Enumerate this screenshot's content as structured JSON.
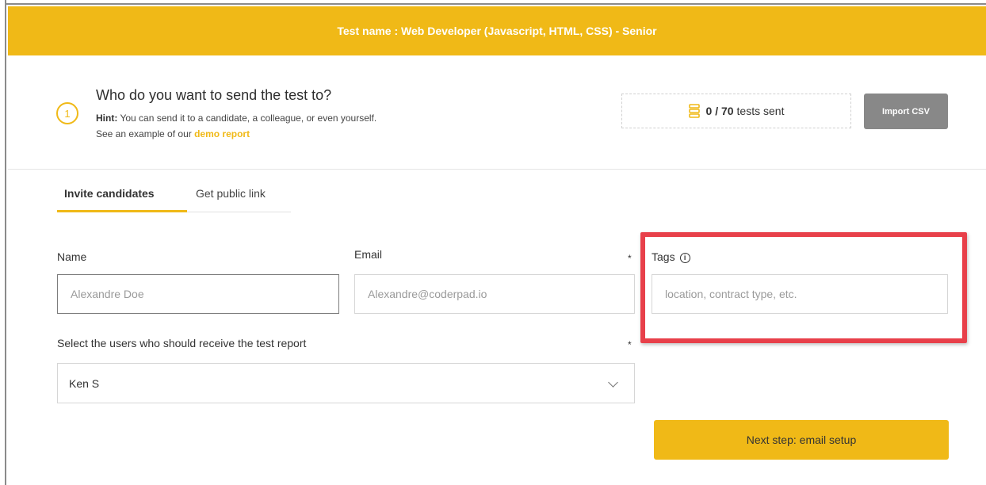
{
  "header": {
    "title": "Test name : Web Developer (Javascript, HTML, CSS) - Senior"
  },
  "step": {
    "number": "1",
    "title": "Who do you want to send the test to?",
    "hint_label": "Hint:",
    "hint_text": " You can send it to a candidate, a colleague, or even yourself.",
    "example_text": "See an example of our ",
    "demo_link": "demo report"
  },
  "quota": {
    "count": "0 / 70",
    "suffix": "tests sent"
  },
  "import_button": "Import CSV",
  "tabs": [
    {
      "label": "Invite candidates",
      "active": true
    },
    {
      "label": "Get public link",
      "active": false
    }
  ],
  "form": {
    "name": {
      "label": "Name",
      "placeholder": "Alexandre Doe"
    },
    "email": {
      "label": "Email",
      "required": "*",
      "placeholder": "Alexandre@coderpad.io"
    },
    "tags": {
      "label": "Tags",
      "placeholder": "location, contract type, etc."
    },
    "report_users": {
      "label": "Select the users who should receive the test report",
      "required": "*",
      "value": "Ken S"
    }
  },
  "next_button": "Next step: email setup",
  "colors": {
    "accent": "#f0b917",
    "highlight": "#e8404a",
    "import_button": "#888888"
  },
  "icons": [
    "coins-icon",
    "info-icon",
    "chevron-down-icon"
  ]
}
